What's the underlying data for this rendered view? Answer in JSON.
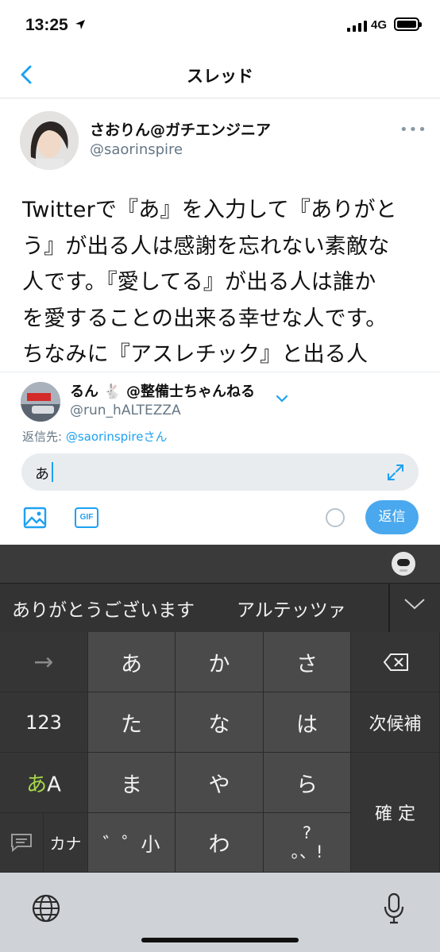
{
  "status_bar": {
    "time": "13:25",
    "network": "4G"
  },
  "nav": {
    "title": "スレッド"
  },
  "tweet": {
    "display_name": "さおりん@ガチエンジニア",
    "handle": "@saorinspire",
    "more": "•••",
    "body_lines": [
      "Twitterで『あ』を入力して『ありがと",
      "う』が出る人は感謝を忘れない素敵な",
      "人です。『愛してる』が出る人は誰か",
      "を愛することの出来る幸せな人です。",
      "ちなみに『アスレチック』と出る人"
    ]
  },
  "reply": {
    "display_name": "るん 🐇 @整備士ちゃんねる",
    "handle": "@run_hALTEZZA",
    "replying_to_label": "返信先: ",
    "replying_to_user": "@saorinspire",
    "replying_to_suffix": "さん",
    "input_value": "あ",
    "gif_label": "GIF",
    "send_label": "返信"
  },
  "keyboard": {
    "candidates": [
      "ありがとうございます",
      "アルテッツァ"
    ],
    "keys": {
      "arrow": "→",
      "a": "あ",
      "ka": "か",
      "sa": "さ",
      "num": "123",
      "ta": "た",
      "na": "な",
      "ha": "は",
      "next_candidate": "次候補",
      "mode_kana": "あ",
      "mode_alpha": "A",
      "ma": "ま",
      "ya": "や",
      "ra": "ら",
      "confirm": "確 定",
      "kana": "カナ",
      "dakuten": "゛゜小",
      "wa": "わ",
      "punct": "?\n。、!"
    }
  },
  "colors": {
    "accent": "#1da1f2",
    "keyboard_bg": "#2c2c2c"
  }
}
